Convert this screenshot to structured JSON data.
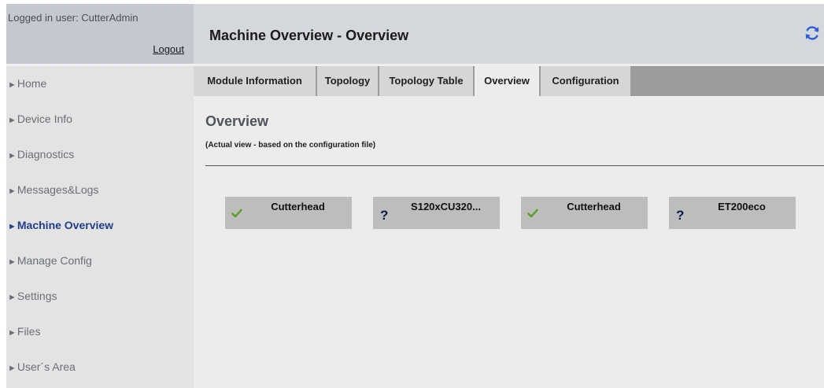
{
  "sidebar": {
    "login_label": "Logged in user: CutterAdmin",
    "logout_label": "Logout",
    "arrow_glyph": "►",
    "items": [
      {
        "label": "Home"
      },
      {
        "label": "Device Info"
      },
      {
        "label": "Diagnostics"
      },
      {
        "label": "Messages&Logs"
      },
      {
        "label": "Machine Overview",
        "active": true
      },
      {
        "label": "Manage Config"
      },
      {
        "label": "Settings"
      },
      {
        "label": "Files"
      },
      {
        "label": "User´s Area"
      }
    ]
  },
  "header": {
    "title": "Machine Overview - Overview",
    "refresh_icon": "refresh-icon"
  },
  "tabs": [
    {
      "label": "Module Information"
    },
    {
      "label": "Topology"
    },
    {
      "label": "Topology Table"
    },
    {
      "label": "Overview",
      "active": true
    },
    {
      "label": "Configuration"
    }
  ],
  "content": {
    "title": "Overview",
    "subtitle": "(Actual view - based on the configuration file)"
  },
  "modules": [
    {
      "name": "Cutterhead",
      "status": "ok"
    },
    {
      "name": "S120xCU320...",
      "status": "unknown"
    },
    {
      "name": "Cutterhead",
      "status": "ok"
    },
    {
      "name": "ET200eco",
      "status": "unknown"
    }
  ],
  "colors": {
    "active_nav": "#1f3d8a",
    "ok_check": "#5aa02c",
    "unknown_mark": "#0f1a4a",
    "refresh_icon": "#2a5bd7"
  }
}
